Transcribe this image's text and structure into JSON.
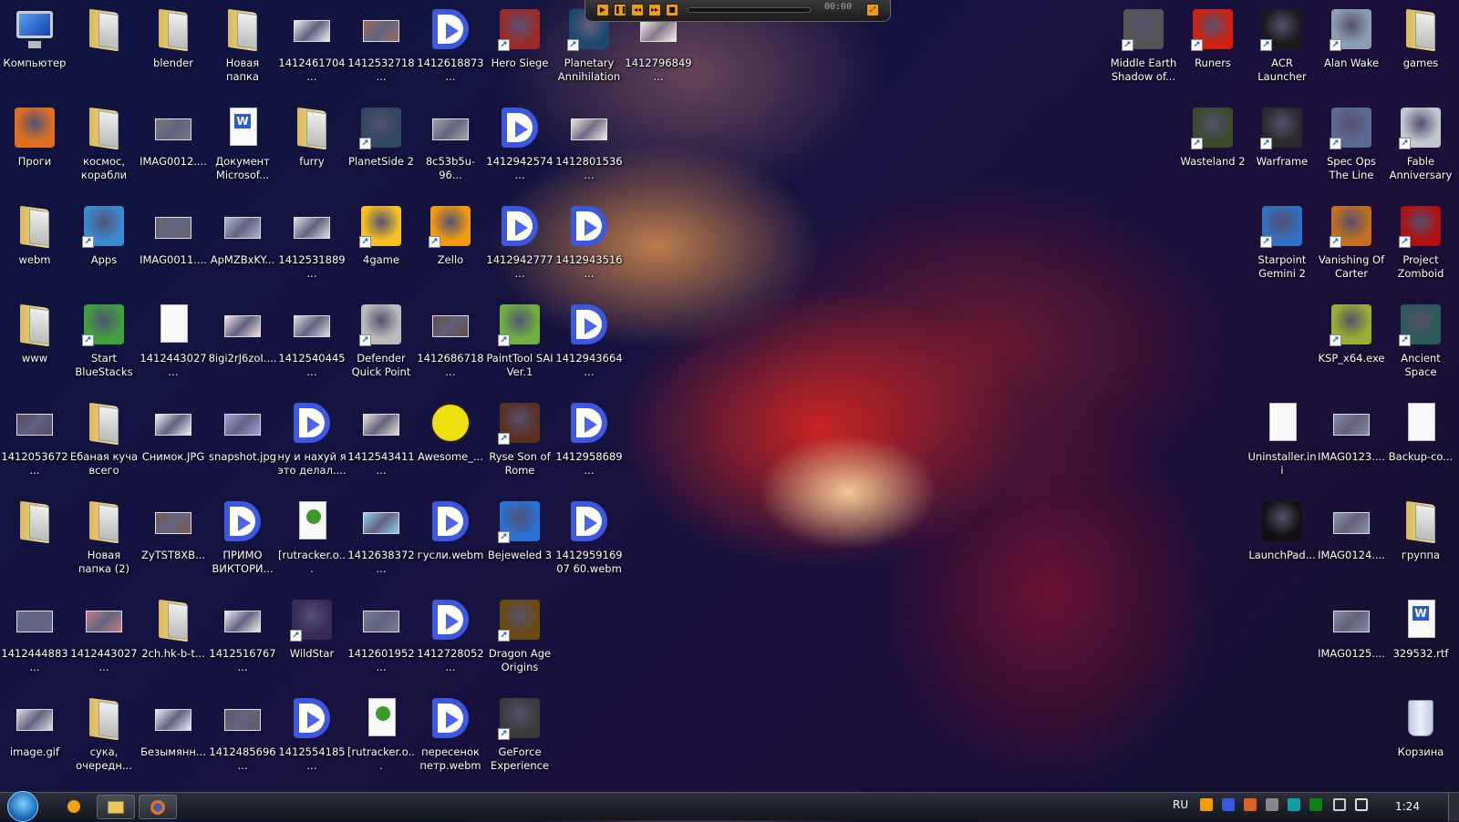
{
  "desktop": {
    "left_grid": [
      [
        {
          "label": "Компьютер",
          "icon": "computer"
        },
        {
          "label": "",
          "icon": "folder"
        },
        {
          "label": "blender",
          "icon": "folder"
        },
        {
          "label": "Новая папка",
          "icon": "folder"
        },
        {
          "label": "1412461704...",
          "icon": "image",
          "color": "#eeeeee"
        },
        {
          "label": "1412532718...",
          "icon": "image",
          "color": "#a06a50"
        },
        {
          "label": "1412618873...",
          "icon": "video"
        },
        {
          "label": "Hero Siege",
          "icon": "game",
          "color": "#9a2a2a",
          "shortcut": true
        },
        {
          "label": "Planetary Annihilation",
          "icon": "game",
          "color": "#1a4a70",
          "shortcut": true
        },
        {
          "label": "1412796849...",
          "icon": "image",
          "color": "#f4f0ea"
        }
      ],
      [
        {
          "label": "Проги",
          "icon": "game",
          "color": "#e07020"
        },
        {
          "label": "космос, корабли",
          "icon": "folder"
        },
        {
          "label": "IMAG0012....",
          "icon": "image",
          "color": "#777777"
        },
        {
          "label": "Документ Microsof...",
          "icon": "word"
        },
        {
          "label": "furry",
          "icon": "folder"
        },
        {
          "label": "PlanetSide 2",
          "icon": "game",
          "color": "#304860",
          "shortcut": true
        },
        {
          "label": "8c53b5u-96...",
          "icon": "image",
          "color": "#a0a8a0"
        },
        {
          "label": "1412942574...",
          "icon": "video"
        },
        {
          "label": "1412801536...",
          "icon": "image",
          "color": "#f0e8e0"
        },
        null
      ],
      [
        {
          "label": "webm",
          "icon": "folder"
        },
        {
          "label": "Apps",
          "icon": "game",
          "color": "#3a8ad0",
          "shortcut": true
        },
        {
          "label": "IMAG0011....",
          "icon": "image",
          "color": "#666666"
        },
        {
          "label": "ApMZBxKY...",
          "icon": "image",
          "color": "#b0b8d0"
        },
        {
          "label": "1412531889...",
          "icon": "image",
          "color": "#dddddd"
        },
        {
          "label": "4game",
          "icon": "game",
          "color": "#f8c020",
          "shortcut": true
        },
        {
          "label": "Zello",
          "icon": "game",
          "color": "#f29a10",
          "shortcut": true
        },
        {
          "label": "1412942777...",
          "icon": "video"
        },
        {
          "label": "1412943516...",
          "icon": "video"
        },
        null
      ],
      [
        {
          "label": "www",
          "icon": "folder"
        },
        {
          "label": "Start BlueStacks",
          "icon": "game",
          "color": "#40a040",
          "shortcut": true
        },
        {
          "label": "1412443027...",
          "icon": "file"
        },
        {
          "label": "8igi2rJ6zoI....",
          "icon": "image",
          "color": "#f4e0e0"
        },
        {
          "label": "1412540445...",
          "icon": "image",
          "color": "#dddddd"
        },
        {
          "label": "Defender Quick Point",
          "icon": "game",
          "color": "#bbbbbb",
          "shortcut": true
        },
        {
          "label": "1412686718...",
          "icon": "image",
          "color": "#6a4a3a"
        },
        {
          "label": "PaintTool SAI Ver.1",
          "icon": "game",
          "color": "#70b040",
          "shortcut": true
        },
        {
          "label": "1412943664...",
          "icon": "video"
        },
        null
      ],
      [
        {
          "label": "1412053672...",
          "icon": "image",
          "color": "#5a4a60"
        },
        {
          "label": "Ебаная куча всего",
          "icon": "folder"
        },
        {
          "label": "Снимок.JPG",
          "icon": "image",
          "color": "#f0f0f4"
        },
        {
          "label": "snapshot.jpg",
          "icon": "image",
          "color": "#a0a0e0"
        },
        {
          "label": "ну и нахуй я это делал....",
          "icon": "video"
        },
        {
          "label": "1412543411...",
          "icon": "image",
          "color": "#e8e0d0"
        },
        {
          "label": "Awesome_...",
          "icon": "smiley"
        },
        {
          "label": "Ryse Son of Rome",
          "icon": "game",
          "color": "#5a3020",
          "shortcut": true
        },
        {
          "label": "1412958689...",
          "icon": "video"
        },
        null
      ],
      [
        {
          "label": "",
          "icon": "folder"
        },
        {
          "label": "Новая папка (2)",
          "icon": "folder"
        },
        {
          "label": "ZyTST8XB...",
          "icon": "image",
          "color": "#7a5a50"
        },
        {
          "label": "ПРИМО ВИКТОРИ...",
          "icon": "video"
        },
        {
          "label": "[rutracker.o...",
          "icon": "torrent"
        },
        {
          "label": "1412638372...",
          "icon": "image",
          "color": "#8ad0f0"
        },
        {
          "label": "гусли.webm",
          "icon": "video"
        },
        {
          "label": "Bejeweled 3",
          "icon": "game",
          "color": "#2a70d0",
          "shortcut": true
        },
        {
          "label": "141295916907 60.webm",
          "icon": "video"
        },
        null
      ],
      [
        {
          "label": "1412444883...",
          "icon": "image",
          "color": "#5a6a90"
        },
        {
          "label": "1412443027...",
          "icon": "image",
          "color": "#c08080"
        },
        {
          "label": "2ch.hk-b-t...",
          "icon": "folder"
        },
        {
          "label": "1412516767...",
          "icon": "image",
          "color": "#eeeeee"
        },
        {
          "label": "WildStar",
          "icon": "game",
          "color": "#3a2a5a",
          "shortcut": true
        },
        {
          "label": "1412601952...",
          "icon": "image",
          "color": "#708090"
        },
        {
          "label": "1412728052...",
          "icon": "video"
        },
        {
          "label": "Dragon Age Origins",
          "icon": "game",
          "color": "#6a4a10",
          "shortcut": true
        },
        null,
        null
      ],
      [
        {
          "label": "image.gif",
          "icon": "image",
          "color": "#dddddd"
        },
        {
          "label": "сука, очередн...",
          "icon": "folder"
        },
        {
          "label": "Безымянн...",
          "icon": "image",
          "color": "#e8eef8"
        },
        {
          "label": "1412485696...",
          "icon": "image",
          "color": "#606060"
        },
        {
          "label": "1412554185...",
          "icon": "video"
        },
        {
          "label": "[rutracker.o...",
          "icon": "torrent"
        },
        {
          "label": "пересенок петр.webm",
          "icon": "video"
        },
        {
          "label": "GeForce Experience",
          "icon": "game",
          "color": "#3a3a3a",
          "shortcut": true
        },
        null,
        null
      ]
    ],
    "right_grid": [
      [
        {
          "label": "Middle Earth Shadow of...",
          "icon": "game",
          "color": "#555555",
          "shortcut": true
        },
        {
          "label": "Runers",
          "icon": "game",
          "color": "#d02010",
          "shortcut": true
        },
        {
          "label": "ACR Launcher",
          "icon": "game",
          "color": "#1a1a1a",
          "shortcut": true
        },
        {
          "label": "Alan Wake",
          "icon": "game",
          "color": "#8aa0b0",
          "shortcut": true
        },
        {
          "label": "games",
          "icon": "folder"
        }
      ],
      [
        null,
        {
          "label": "Wasteland 2",
          "icon": "game",
          "color": "#3a4a2a",
          "shortcut": true
        },
        {
          "label": "Warframe",
          "icon": "game",
          "color": "#2a2a2a",
          "shortcut": true
        },
        {
          "label": "Spec Ops The Line",
          "icon": "game",
          "color": "#5a6a90",
          "shortcut": true
        },
        {
          "label": "Fable Anniversary",
          "icon": "game",
          "color": "#c0c8d0",
          "shortcut": true
        }
      ],
      [
        null,
        null,
        {
          "label": "Starpoint Gemini 2",
          "icon": "game",
          "color": "#3070c0",
          "shortcut": true
        },
        {
          "label": "Vanishing Of Carter",
          "icon": "game",
          "color": "#c07020",
          "shortcut": true
        },
        {
          "label": "Project Zomboid",
          "icon": "game",
          "color": "#b01010",
          "shortcut": true
        }
      ],
      [
        null,
        null,
        null,
        {
          "label": "KSP_x64.exe",
          "icon": "game",
          "color": "#9ab030",
          "shortcut": true
        },
        {
          "label": "Ancient Space",
          "icon": "game",
          "color": "#2a5a5a",
          "shortcut": true
        }
      ],
      [
        null,
        null,
        {
          "label": "Uninstaller.ini",
          "icon": "file"
        },
        {
          "label": "IMAG0123....",
          "icon": "image",
          "color": "#8090a8"
        },
        {
          "label": "Backup-co...",
          "icon": "file"
        }
      ],
      [
        null,
        null,
        {
          "label": "LaunchPad...",
          "icon": "game",
          "color": "#111111"
        },
        {
          "label": "IMAG0124....",
          "icon": "image",
          "color": "#8898a8"
        },
        {
          "label": "группа",
          "icon": "folder"
        }
      ],
      [
        null,
        null,
        null,
        {
          "label": "IMAG0125....",
          "icon": "image",
          "color": "#8090a8"
        },
        {
          "label": "329532.rtf",
          "icon": "word"
        }
      ],
      [
        null,
        null,
        null,
        null,
        {
          "label": "Корзина",
          "icon": "recycle-bin"
        }
      ]
    ]
  },
  "player": {
    "time": "00:00",
    "buttons": [
      "play",
      "pause",
      "previous",
      "next",
      "stop"
    ]
  },
  "taskbar": {
    "language": "RU",
    "clock": "1:24",
    "pinned": [
      "explorer",
      "firefox"
    ]
  },
  "tray_colors": [
    "#f49a10",
    "#3b58e0",
    "#e06020",
    "#888888",
    "#10a0a0",
    "#108010"
  ]
}
